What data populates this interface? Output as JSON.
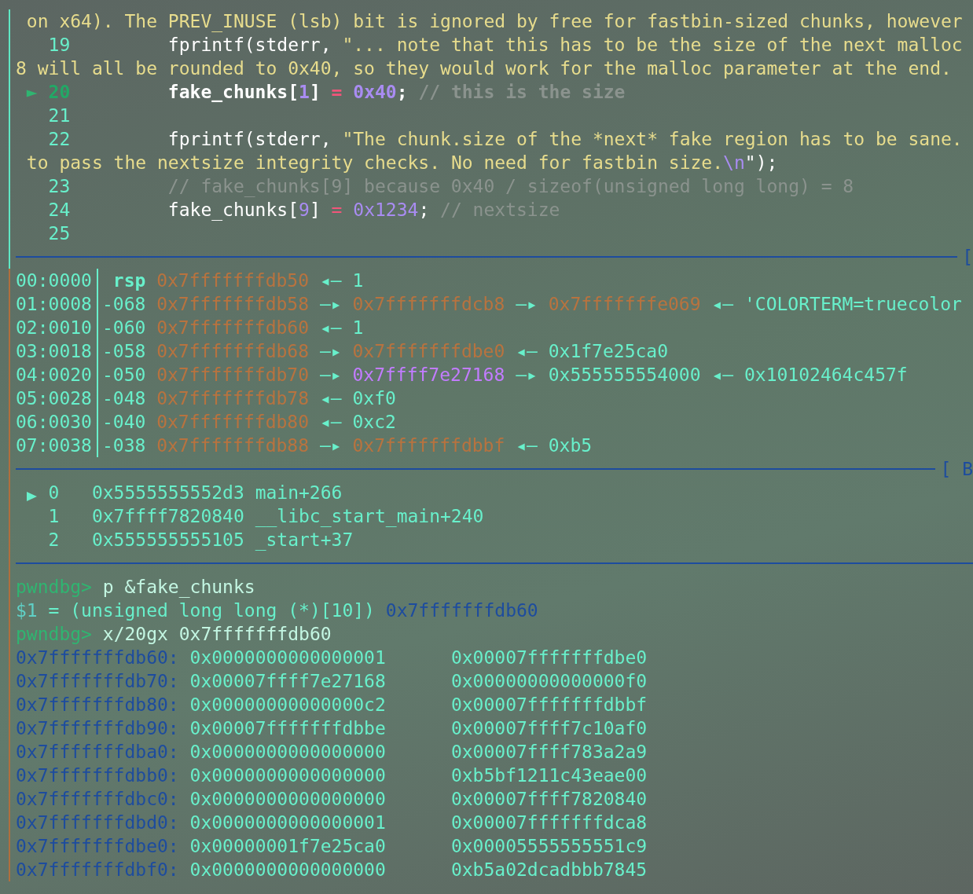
{
  "source_panel": {
    "lines": [
      {
        "kind": "wrap",
        "segments": [
          {
            "kind": "string",
            "text": " on x64). The PREV_INUSE (lsb) bit is ignored by free for fastbin-sized chunks, however"
          }
        ]
      },
      {
        "kind": "numbered",
        "number": "19",
        "current": false,
        "segments": [
          {
            "kind": "plain",
            "text": "fprintf(stderr, "
          },
          {
            "kind": "string",
            "text": "\"... note that this has to be the size of the next malloc"
          }
        ]
      },
      {
        "kind": "wrap",
        "segments": [
          {
            "kind": "string",
            "text": "8 will all be rounded to 0x40, so they would work for the malloc parameter at the end."
          }
        ]
      },
      {
        "kind": "numbered",
        "number": "20",
        "current": true,
        "marker": "►",
        "segments": [
          {
            "kind": "plain",
            "text": "fake_chunks["
          },
          {
            "kind": "number",
            "text": "1"
          },
          {
            "kind": "plain",
            "text": "] "
          },
          {
            "kind": "operator",
            "text": "= "
          },
          {
            "kind": "number",
            "text": "0x40"
          },
          {
            "kind": "plain",
            "text": "; "
          },
          {
            "kind": "comment",
            "text": "// this is the size"
          }
        ]
      },
      {
        "kind": "numbered",
        "number": "21",
        "current": false
      },
      {
        "kind": "numbered",
        "number": "22",
        "current": false,
        "segments": [
          {
            "kind": "plain",
            "text": "fprintf(stderr, "
          },
          {
            "kind": "string",
            "text": "\"The chunk.size of the *next* fake region has to be sane."
          }
        ]
      },
      {
        "kind": "wrap",
        "segments": [
          {
            "kind": "string",
            "text": " to pass the nextsize integrity checks. No need for fastbin size."
          },
          {
            "kind": "escape",
            "text": "\\n"
          },
          {
            "kind": "plain",
            "text": "\");"
          }
        ]
      },
      {
        "kind": "numbered",
        "number": "23",
        "current": false,
        "segments": [
          {
            "kind": "comment",
            "text": "// fake_chunks[9] because 0x40 / sizeof(unsigned long long) = 8"
          }
        ]
      },
      {
        "kind": "numbered",
        "number": "24",
        "current": false,
        "segments": [
          {
            "kind": "plain",
            "text": "fake_chunks["
          },
          {
            "kind": "number",
            "text": "9"
          },
          {
            "kind": "plain",
            "text": "] "
          },
          {
            "kind": "operator",
            "text": "= "
          },
          {
            "kind": "number",
            "text": "0x1234"
          },
          {
            "kind": "plain",
            "text": "; "
          },
          {
            "kind": "comment",
            "text": "// nextsize"
          }
        ]
      },
      {
        "kind": "numbered",
        "number": "25",
        "current": false
      }
    ],
    "footer_label": "["
  },
  "stack_panel": {
    "rows": [
      {
        "offset": "00:0000",
        "label": "rsp",
        "kind": "register",
        "chain": [
          {
            "kind": "stack",
            "text": "0x7fffffffdb50"
          },
          {
            "kind": "arrow",
            "text": "◂—"
          },
          {
            "kind": "value",
            "text": "1"
          }
        ]
      },
      {
        "offset": "01:0008",
        "label": "-068",
        "kind": "delta",
        "chain": [
          {
            "kind": "stack",
            "text": "0x7fffffffdb58"
          },
          {
            "kind": "arrow",
            "text": "—▸"
          },
          {
            "kind": "stack",
            "text": "0x7fffffffdcb8"
          },
          {
            "kind": "arrow",
            "text": "—▸"
          },
          {
            "kind": "stack",
            "text": "0x7fffffffe069"
          },
          {
            "kind": "arrow",
            "text": "◂—"
          },
          {
            "kind": "value",
            "text": "'COLORTERM=truecolor"
          }
        ]
      },
      {
        "offset": "02:0010",
        "label": "-060",
        "kind": "delta",
        "chain": [
          {
            "kind": "stack",
            "text": "0x7fffffffdb60"
          },
          {
            "kind": "arrow",
            "text": "◂—"
          },
          {
            "kind": "value",
            "text": "1"
          }
        ]
      },
      {
        "offset": "03:0018",
        "label": "-058",
        "kind": "delta",
        "chain": [
          {
            "kind": "stack",
            "text": "0x7fffffffdb68"
          },
          {
            "kind": "arrow",
            "text": "—▸"
          },
          {
            "kind": "stack",
            "text": "0x7fffffffdbe0"
          },
          {
            "kind": "arrow",
            "text": "◂—"
          },
          {
            "kind": "value",
            "text": "0x1f7e25ca0"
          }
        ]
      },
      {
        "offset": "04:0020",
        "label": "-050",
        "kind": "delta",
        "chain": [
          {
            "kind": "stack",
            "text": "0x7fffffffdb70"
          },
          {
            "kind": "arrow",
            "text": "—▸"
          },
          {
            "kind": "code",
            "text": "0x7ffff7e27168"
          },
          {
            "kind": "arrow",
            "text": "—▸"
          },
          {
            "kind": "value",
            "text": "0x555555554000"
          },
          {
            "kind": "arrow",
            "text": "◂—"
          },
          {
            "kind": "value",
            "text": "0x10102464c457f"
          }
        ]
      },
      {
        "offset": "05:0028",
        "label": "-048",
        "kind": "delta",
        "chain": [
          {
            "kind": "stack",
            "text": "0x7fffffffdb78"
          },
          {
            "kind": "arrow",
            "text": "◂—"
          },
          {
            "kind": "value",
            "text": "0xf0"
          }
        ]
      },
      {
        "offset": "06:0030",
        "label": "-040",
        "kind": "delta",
        "chain": [
          {
            "kind": "stack",
            "text": "0x7fffffffdb80"
          },
          {
            "kind": "arrow",
            "text": "◂—"
          },
          {
            "kind": "value",
            "text": "0xc2"
          }
        ]
      },
      {
        "offset": "07:0038",
        "label": "-038",
        "kind": "delta",
        "chain": [
          {
            "kind": "stack",
            "text": "0x7fffffffdb88"
          },
          {
            "kind": "arrow",
            "text": "—▸"
          },
          {
            "kind": "stack",
            "text": "0x7fffffffdbbf"
          },
          {
            "kind": "arrow",
            "text": "◂—"
          },
          {
            "kind": "value",
            "text": "0xb5"
          }
        ]
      }
    ],
    "footer_label": "[ B"
  },
  "backtrace_panel": {
    "frames": [
      {
        "current": true,
        "index": "0",
        "address": "0x5555555552d3",
        "symbol": "main+266"
      },
      {
        "current": false,
        "index": "1",
        "address": "0x7ffff7820840",
        "symbol": "__libc_start_main+240"
      },
      {
        "current": false,
        "index": "2",
        "address": "0x555555555105",
        "symbol": "_start+37"
      }
    ]
  },
  "console": {
    "lines": [
      {
        "kind": "command",
        "prompt": "pwndbg>",
        "command": "p &fake_chunks"
      },
      {
        "kind": "result",
        "variable": "$1",
        "text": " = (unsigned long long (*)[10]) ",
        "address": "0x7fffffffdb60"
      },
      {
        "kind": "command",
        "prompt": "pwndbg>",
        "command": "x/20gx 0x7fffffffdb60"
      },
      {
        "kind": "memory",
        "address": "0x7fffffffdb60:",
        "values": [
          "0x0000000000000001",
          "0x00007fffffffdbe0"
        ]
      },
      {
        "kind": "memory",
        "address": "0x7fffffffdb70:",
        "values": [
          "0x00007ffff7e27168",
          "0x00000000000000f0"
        ]
      },
      {
        "kind": "memory",
        "address": "0x7fffffffdb80:",
        "values": [
          "0x00000000000000c2",
          "0x00007fffffffdbbf"
        ]
      },
      {
        "kind": "memory",
        "address": "0x7fffffffdb90:",
        "values": [
          "0x00007fffffffdbbe",
          "0x00007ffff7c10af0"
        ]
      },
      {
        "kind": "memory",
        "address": "0x7fffffffdba0:",
        "values": [
          "0x0000000000000000",
          "0x00007ffff783a2a9"
        ]
      },
      {
        "kind": "memory",
        "address": "0x7fffffffdbb0:",
        "values": [
          "0x0000000000000000",
          "0xb5bf1211c43eae00"
        ]
      },
      {
        "kind": "memory",
        "address": "0x7fffffffdbc0:",
        "values": [
          "0x0000000000000000",
          "0x00007ffff7820840"
        ]
      },
      {
        "kind": "memory",
        "address": "0x7fffffffdbd0:",
        "values": [
          "0x0000000000000001",
          "0x00007fffffffdca8"
        ]
      },
      {
        "kind": "memory",
        "address": "0x7fffffffdbe0:",
        "values": [
          "0x00000001f7e25ca0",
          "0x00005555555551c9"
        ]
      },
      {
        "kind": "memory",
        "address": "0x7fffffffdbf0:",
        "values": [
          "0x0000000000000000",
          "0xb5a02dcadbbb7845"
        ]
      }
    ]
  }
}
